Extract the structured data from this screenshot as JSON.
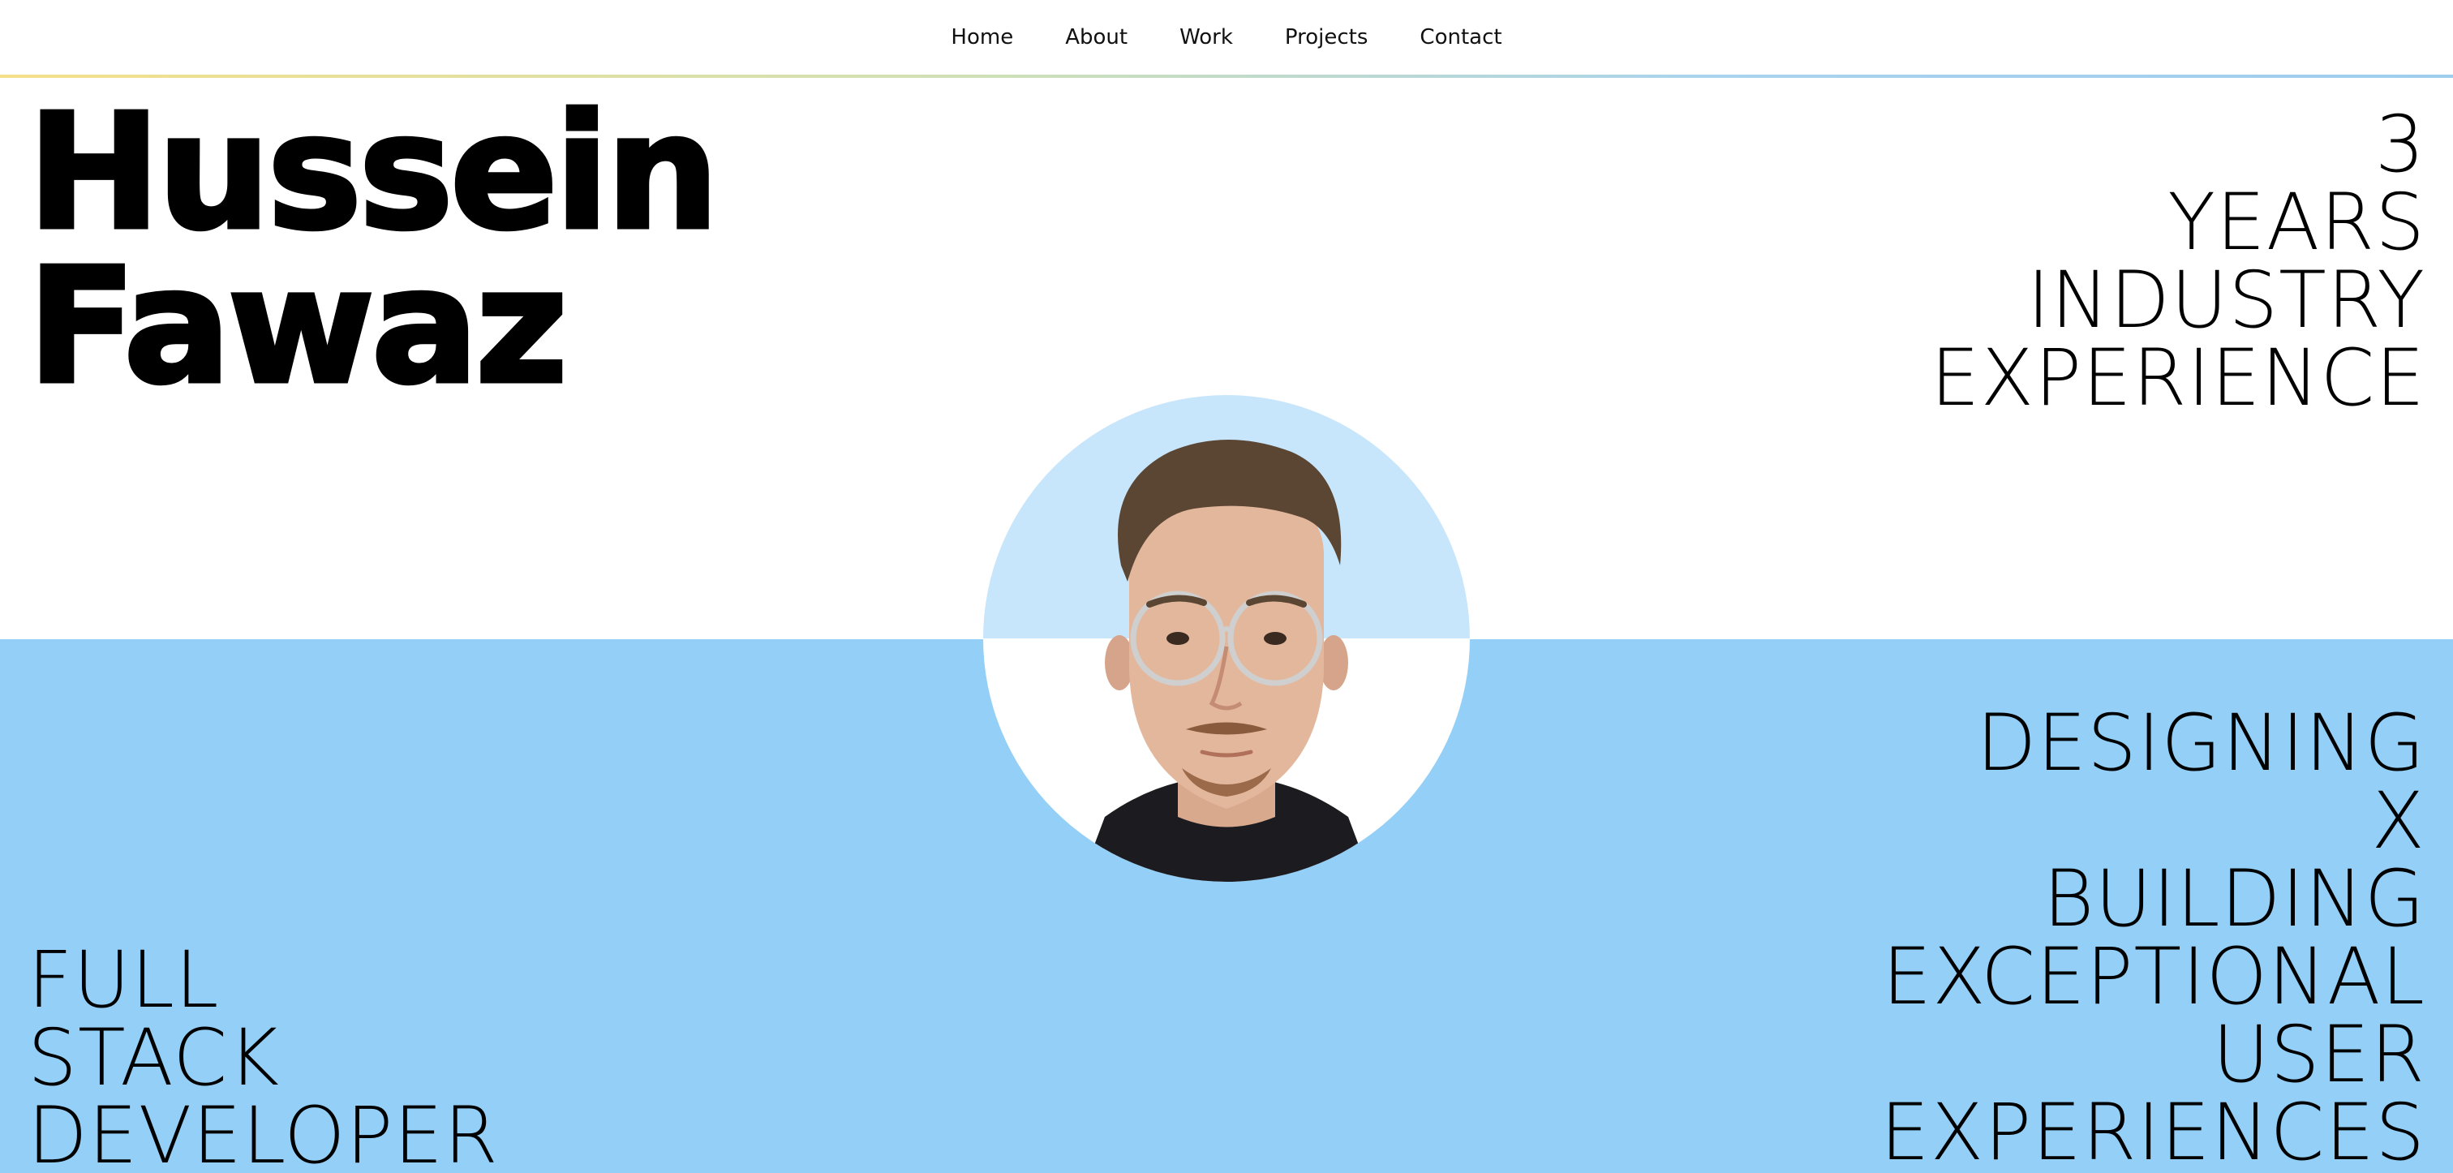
{
  "nav": {
    "items": [
      {
        "label": "Home"
      },
      {
        "label": "About"
      },
      {
        "label": "Work"
      },
      {
        "label": "Projects"
      },
      {
        "label": "Contact"
      }
    ]
  },
  "hero": {
    "name_line1": "Hussein",
    "name_line2": "Fawaz",
    "experience": [
      "3",
      "YEARS",
      "INDUSTRY",
      "EXPERIENCE"
    ],
    "tagline": [
      "DESIGNING",
      "X",
      "BUILDING",
      "EXCEPTIONAL",
      "USER",
      "EXPERIENCES"
    ],
    "role": [
      "FULL",
      "STACK",
      "DEVELOPER"
    ],
    "avatar_icon": "profile-photo"
  },
  "colors": {
    "band": "#93cff6",
    "avatar_bg": "#c8e6fb",
    "nav_line_start": "#f5e08a",
    "nav_line_end": "#9fcdee"
  }
}
